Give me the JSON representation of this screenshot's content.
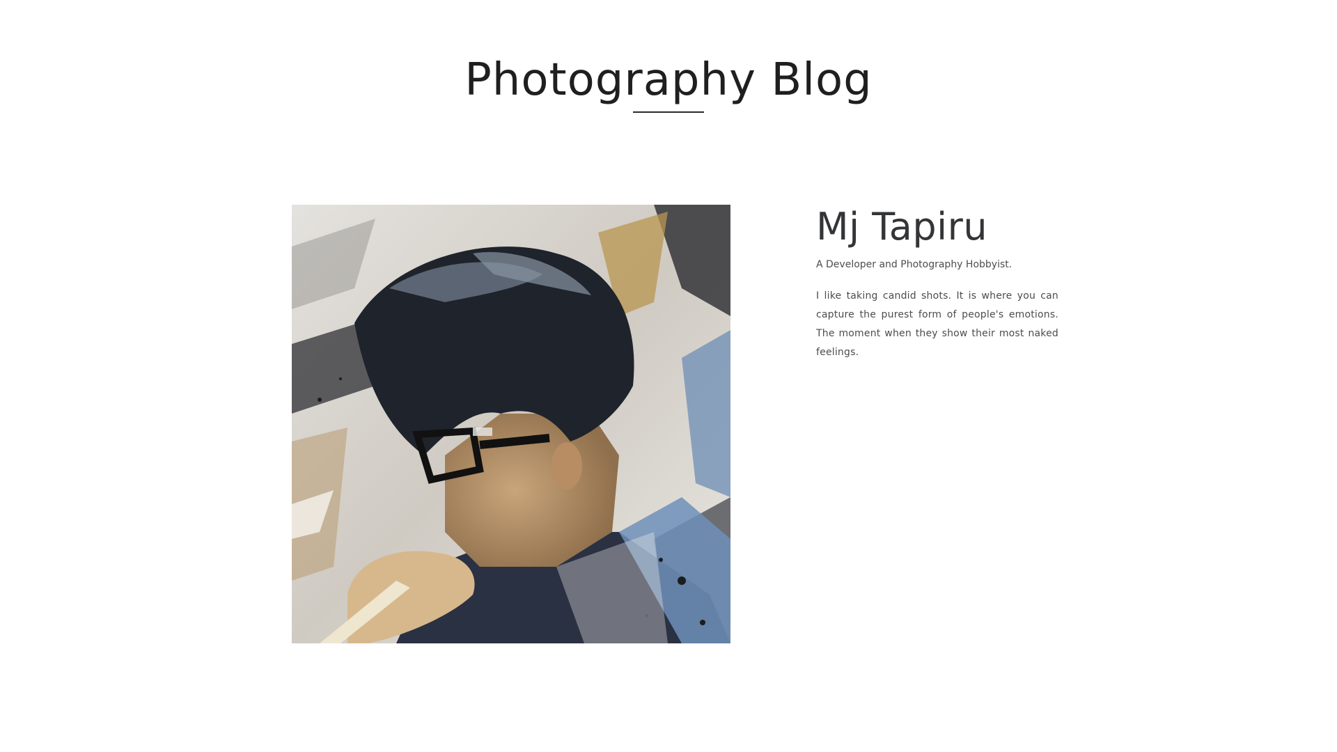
{
  "header": {
    "title": "Photography Blog"
  },
  "profile": {
    "photo_alt": "Portrait of Mj Tapiru",
    "name": "Mj Tapiru",
    "tagline": "A Developer and Photography Hobbyist.",
    "bio": "I like taking candid shots. It is where you can capture the purest form of people's emotions. The moment when they show their most naked feelings."
  },
  "colors": {
    "background": "#ffffff",
    "text": "#2f3133",
    "accent_underline": "#2a2a2a"
  }
}
